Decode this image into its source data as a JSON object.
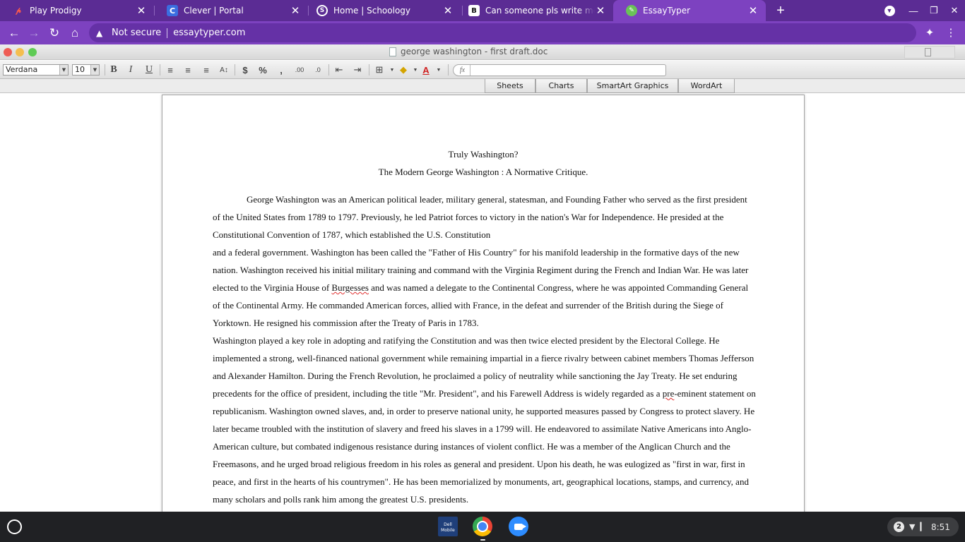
{
  "tabs": [
    {
      "title": "Play Prodigy",
      "icon": "prodigy-icon",
      "active": false
    },
    {
      "title": "Clever | Portal",
      "icon": "clever-icon",
      "active": false
    },
    {
      "title": "Home | Schoology",
      "icon": "schoology-icon",
      "active": false
    },
    {
      "title": "Can someone pls write me a pa",
      "icon": "brainly-icon",
      "active": false
    },
    {
      "title": "EssayTyper",
      "icon": "essaytyper-icon",
      "active": true
    }
  ],
  "address_bar": {
    "security_label": "Not secure",
    "url": "essaytyper.com"
  },
  "document": {
    "filename": "george washington - first draft.doc",
    "font_name": "Verdana",
    "font_size": "10",
    "ribbon_tabs": [
      "Sheets",
      "Charts",
      "SmartArt Graphics",
      "WordArt"
    ],
    "title": "Truly Washington?",
    "subtitle": "The Modern George Washington : A Normative Critique.",
    "paragraphs": {
      "p1": "George Washington  was an American political leader, military general, statesman, and Founding Father who served as the first president of the United States from 1789 to 1797. Previously, he led Patriot forces to victory in the nation's War for Independence. He presided at the Constitutional Convention of 1787, which established the U.S. Constitution",
      "p2_a": "and a federal government. Washington has been called the \"Father of His Country\" for his manifold leadership in the formative days of the new nation. Washington received his initial military training and command with the Virginia Regiment during the French and Indian War. He was later elected to the Virginia House of ",
      "p2_b": "Burgesses",
      "p2_c": " and was named a delegate to the Continental Congress, where he was appointed Commanding General of the Continental Army. He commanded American forces, allied with France, in the defeat and surrender of the British during the Siege of Yorktown. He resigned his commission after the Treaty of Paris in 1783.",
      "p3_a": "Washington played a key role in adopting and ratifying the Constitution and was then twice elected president by the Electoral College. He implemented a strong, well-financed national government while remaining impartial in a fierce rivalry between cabinet members Thomas Jefferson and Alexander Hamilton. During the French Revolution, he proclaimed a policy of neutrality while sanctioning the Jay Treaty. He set enduring precedents for the office of president, including the title \"Mr. President\", and his Farewell Address is widely regarded as a ",
      "p3_b": "pre",
      "p3_c": "-eminent statement on republicanism. Washington owned slaves, and, in order to preserve national unity, he supported measures passed by Congress to protect slavery. He later became troubled with the institution of slavery and freed his slaves in a 1799 will. He endeavored to assimilate Native Americans into Anglo-American culture, but combated indigenous resistance during instances of violent conflict. He was a member of the Anglican Church and the Freemasons, and he urged broad religious freedom in his roles as general and president. Upon his death, he was eulogized as \"first in war, first in peace, and first in the hearts of his countrymen\". He has been memorialized by monuments, art, geographical locations, stamps, and currency, and many scholars and polls rank him among the greatest U.S. presidents."
    }
  },
  "shelf": {
    "notification_count": "2",
    "time": "8:51",
    "dell_label": "Dell Mobile"
  },
  "colors": {
    "tabstrip": "#5b2c94",
    "toolbar": "#7d42c0",
    "shelf": "#202124"
  }
}
